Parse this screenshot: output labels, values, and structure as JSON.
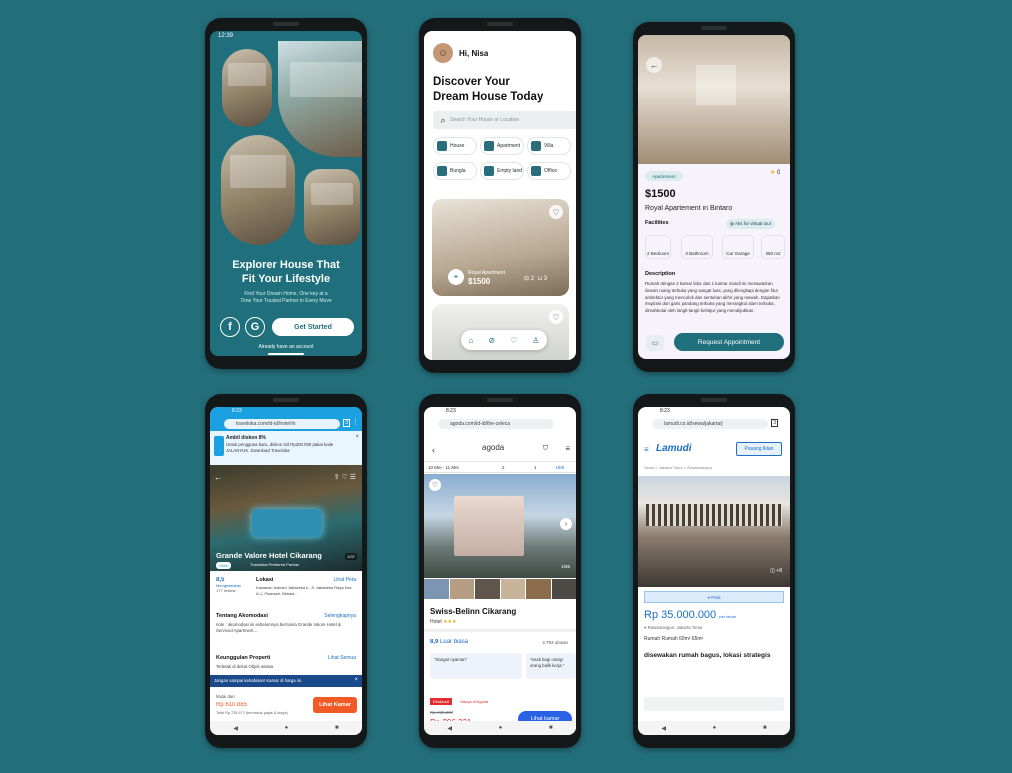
{
  "phone1": {
    "time": "12:39",
    "headline_line1": "Explorer House That",
    "headline_line2": "Fit Your Lifestyle",
    "sub_line1": "Find Your Dream Home, One key at a",
    "sub_line2": "Time Your Trusted Partner in Every Move",
    "facebook_glyph": "f",
    "google_glyph": "G",
    "cta": "Get Started",
    "login_link": "Already have an account"
  },
  "phone2": {
    "greeting": "Hi, Nisa",
    "title_line1": "Discover Your",
    "title_line2": "Dream House Today",
    "search_placeholder": "Search Your House or Location",
    "categories": [
      "House",
      "Apartment",
      "Villa",
      "Bungla",
      "Empty land",
      "Office"
    ],
    "card_title": "Royal Apartment",
    "card_price": "$1500",
    "beds": "2",
    "baths": "3"
  },
  "phone3": {
    "tag": "Apartement",
    "rating": "0",
    "price": "$1500",
    "name": "Royal Apartement in Bintaro",
    "facilities_label": "Facilities",
    "virtual_tour": "Aks for virtual tour",
    "facilities": [
      "2 Bedroom",
      "3 Bathroom",
      "Car Garage",
      "350 m2"
    ],
    "description_label": "Description",
    "description": "Rumah dengan 2 kamar tidur dan 1 kamar mandi ini menawarkan desain ruang terbuka yang sangat luas, yang dilengkapi dengan fitur arsitektur yang mencolok dan sentuhan akhir yang mewah. Dapatkan inspirasi dari garis pandang terbuka yang merangkul alam terbuka, dimahkotai oleh langit-langit berlajur yang menakjubkan.",
    "cta": "Request Appointment"
  },
  "phone4": {
    "time": "8:23",
    "url": "traveloka.com/id-id/hotel/in",
    "tab_count": "3",
    "promo_title": "Ambil diskon 8%",
    "promo_body": "Untuk pengguna baru, diskon s/d Rp200.000 pakai kode JALANYUK. Download Traveloka",
    "hotel_name": "Grande Valore Hotel Cikarang",
    "photo_count": "1/37",
    "badge": "Hotel",
    "partner": "Traveloka Preferred Partner",
    "rating": "8,5",
    "rating_label": "Mengesankan",
    "reviews": "177 review",
    "location_label": "Lokasi",
    "map_link": "Lihat Peta",
    "address": "Kawasan Industri Jababeka II, Jl. Jababeka Raya Kav A-1, Pasirsari, Bekasi...",
    "about_label": "Tentang Akomodasi",
    "about_link": "Selengkapnya",
    "about_text": "note : akomodasi ini sebelumnya bernama Grande Valore Hotel & Serviced Apartment...",
    "facility_label": "Keunggulan Properti",
    "facility_link": "Lihat Semua",
    "facility_text": "Terletak di dekat Objek wisata",
    "alert": "Jangan sampai kehabisan! Kamar di harga ini.",
    "price_label": "Mulai dari",
    "price_old": "Rp 610.885",
    "price": "Total Rp 735.972 (termasuk pajak & biaya)",
    "cta": "Lihat Kamar"
  },
  "phone5": {
    "time": "8:23",
    "url": "agoda.com/id-id/the-celeca",
    "logo": "agoda",
    "dates": "10 Mei - 11 Mei",
    "guests": "2",
    "rooms": "1",
    "search_label": "Ubh",
    "photo_count": "1/65",
    "hotel_name": "Swiss-Belinn Cikarang",
    "hotel_type": "Hotel",
    "rating": "8,9",
    "rating_label": "Luar biasa",
    "reviews": "3.793 ulasan",
    "review1": "\"Sangat nyaman\"",
    "review2": "\"enak bagi orang-orang balik kerja.\"",
    "tag": "Eksklusif",
    "tag_text": "Hanya di Agoda",
    "price_old": "Rp 439.207",
    "price": "Rp 296.331",
    "cta": "Lihat kamar"
  },
  "phone6": {
    "time": "8:23",
    "url": "lamudi.co.id/sewa/jakarta/j",
    "tab_count": "3",
    "logo": "Lamudi",
    "post_button": "Pasang Iklan",
    "breadcrumb": "Sewa > Jakarta Timur > Rawamangun",
    "photo_count": "+8",
    "map_label": "Peta",
    "price": "Rp 35.000.000",
    "price_unit": "per tahun",
    "location": "Rawamangun, Jakarta Timur",
    "specs": "Rumah  Rumah 60m² 65m²",
    "title": "disewakan rumah bagus, lokasi strategis"
  }
}
